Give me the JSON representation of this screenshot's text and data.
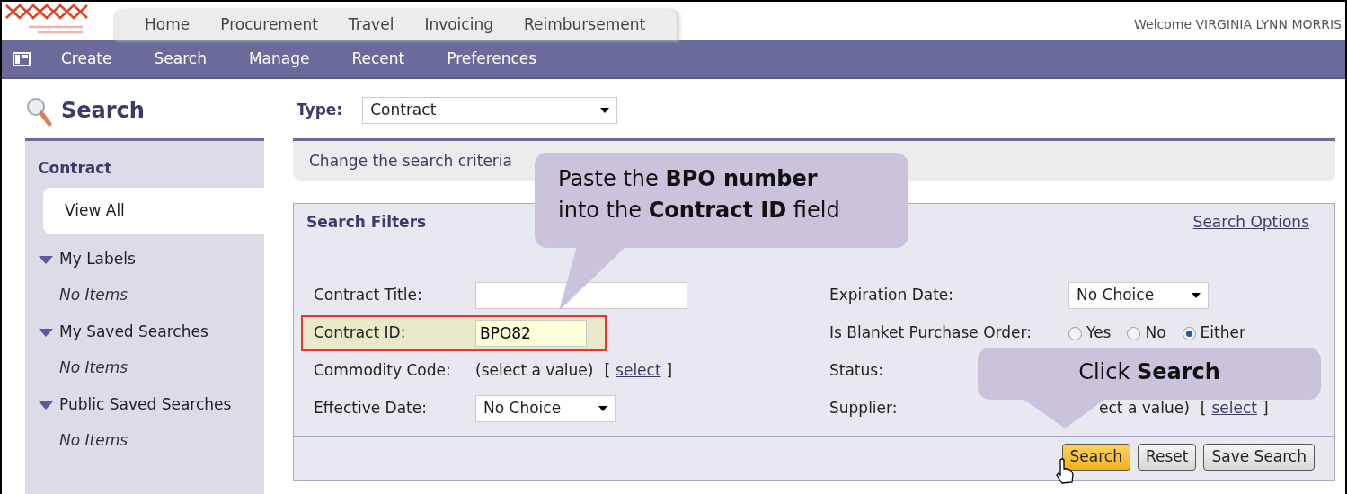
{
  "header": {
    "top_tabs": [
      {
        "label": "Home"
      },
      {
        "label": "Procurement"
      },
      {
        "label": "Travel"
      },
      {
        "label": "Invoicing"
      },
      {
        "label": "Reimbursement"
      }
    ],
    "welcome": "Welcome VIRGINIA LYNN MORRIS"
  },
  "navbar": {
    "items": [
      {
        "label": "Create"
      },
      {
        "label": "Search"
      },
      {
        "label": "Manage"
      },
      {
        "label": "Recent"
      },
      {
        "label": "Preferences"
      }
    ]
  },
  "sidebar": {
    "title": "Search",
    "section": "Contract",
    "items": [
      {
        "label": "View All",
        "selected": true
      }
    ],
    "groups": [
      {
        "label": "My Labels",
        "expanded": true,
        "empty_text": "No Items"
      },
      {
        "label": "My Saved Searches",
        "expanded": true,
        "empty_text": "No Items"
      },
      {
        "label": "Public Saved Searches",
        "expanded": true,
        "empty_text": "No Items"
      }
    ]
  },
  "main": {
    "type_label": "Type:",
    "type_value": "Contract",
    "info": "Change the search criteria",
    "filters": {
      "title": "Search Filters",
      "options_link": "Search Options",
      "rows": [
        {
          "left": {
            "kind": "text",
            "label": "Contract Title:",
            "highlighted": false
          },
          "right": {
            "kind": "select",
            "label": "Expiration Date:",
            "value": "No Choice"
          }
        },
        {
          "left": {
            "kind": "text",
            "label": "Contract ID:",
            "value": "BPO82",
            "highlighted": true
          },
          "right": {
            "kind": "radio",
            "label": "Is Blanket Purchase Order:",
            "options": [
              {
                "label": "Yes",
                "selected": false
              },
              {
                "label": "No",
                "selected": false
              },
              {
                "label": "Either",
                "selected": true
              }
            ]
          }
        },
        {
          "left": {
            "kind": "picker",
            "label": "Commodity Code:",
            "value": "(select a value)",
            "open": "[",
            "link": "select",
            "close": "]",
            "highlighted": false
          },
          "right": {
            "kind": "none",
            "label": "Status:"
          }
        },
        {
          "left": {
            "kind": "select",
            "label": "Effective Date:",
            "value": "No Choice",
            "highlighted": false
          },
          "right": {
            "kind": "picker",
            "label": "Supplier:",
            "value": "ect a value)",
            "open": "[",
            "link": "select",
            "close": "]"
          }
        }
      ]
    },
    "buttons": [
      {
        "label": "Search",
        "primary": true
      },
      {
        "label": "Reset",
        "primary": false
      },
      {
        "label": "Save Search",
        "primary": false
      }
    ]
  },
  "callouts": [
    {
      "text": "Paste the **BPO number**\ninto the **Contract ID** field"
    },
    {
      "text": "Click **Search**"
    }
  ]
}
